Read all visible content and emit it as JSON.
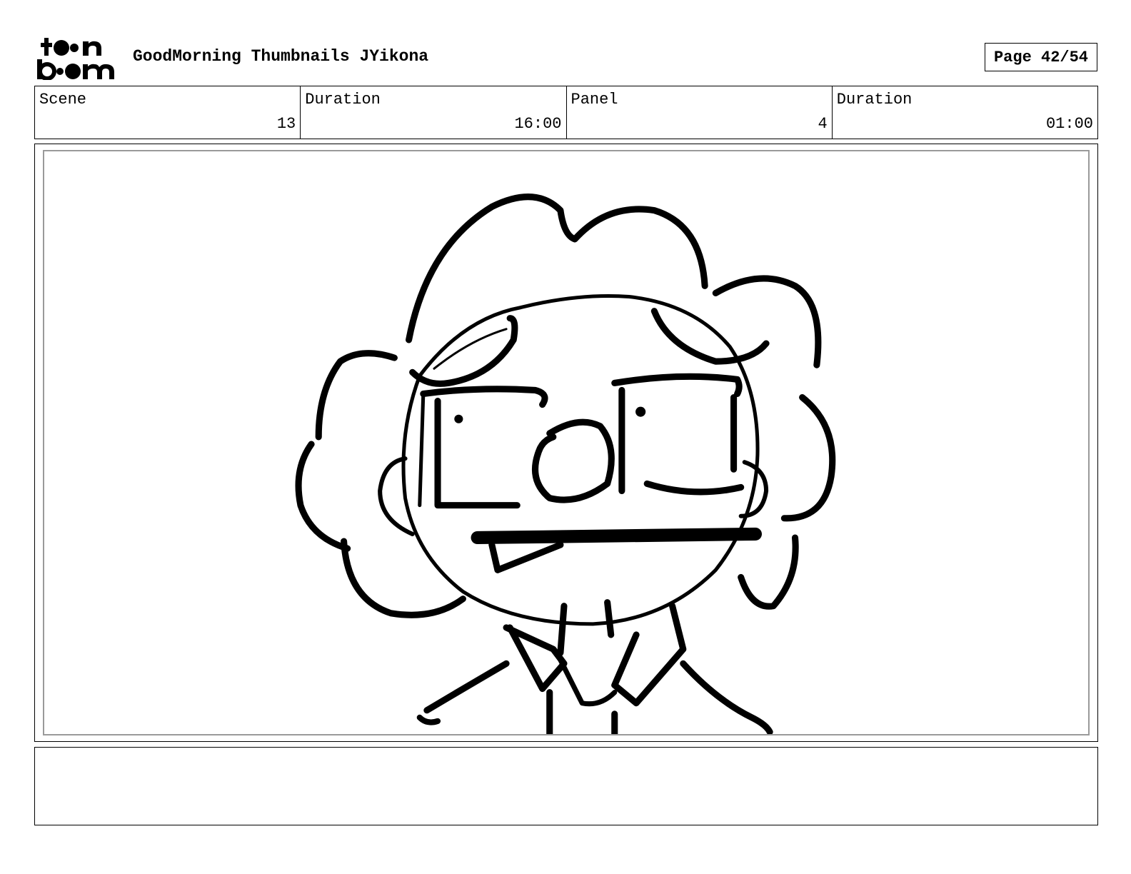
{
  "header": {
    "logo_top": "toon",
    "logo_bottom": "boom",
    "document_title": "GoodMorning Thumbnails JYikona",
    "page_label": "Page 42/54"
  },
  "info": {
    "scene_label": "Scene",
    "scene_value": "13",
    "scene_duration_label": "Duration",
    "scene_duration_value": "16:00",
    "panel_label": "Panel",
    "panel_value": "4",
    "panel_duration_label": "Duration",
    "panel_duration_value": "01:00"
  },
  "panel": {
    "image_description": "Rough storyboard sketch of a character with curly hair and glasses, mouth in a flat line"
  },
  "notes": {
    "text": ""
  }
}
